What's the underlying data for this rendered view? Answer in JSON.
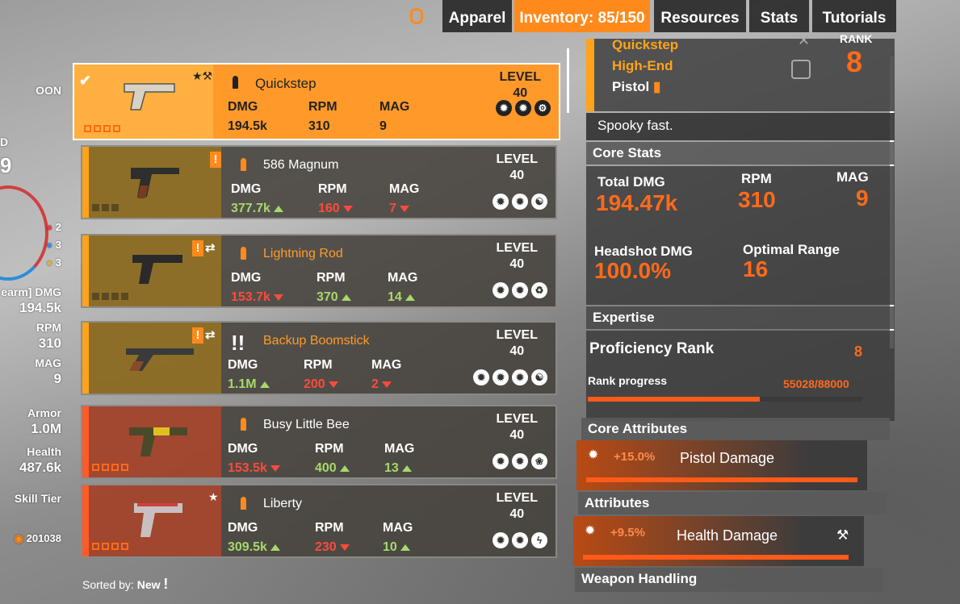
{
  "colors": {
    "accent": "#ff8a1c",
    "stat_up": "#a6d96a",
    "stat_down": "#ff4a3a"
  },
  "nav": {
    "tabs": [
      {
        "label": "Apparel",
        "active": false
      },
      {
        "label": "Inventory: 85/150",
        "active": true
      },
      {
        "label": "Resources",
        "active": false
      },
      {
        "label": "Stats",
        "active": false
      },
      {
        "label": "Tutorials",
        "active": false
      }
    ]
  },
  "left": {
    "title_fragment": "OON",
    "d_fragment": "D",
    "nine_fragment": "9",
    "counts": [
      "2",
      "3",
      "3"
    ],
    "dmg_label": "earm] DMG",
    "dmg_value": "194.5k",
    "rpm_label": "RPM",
    "rpm_value": "310",
    "mag_label": "MAG",
    "mag_value": "9",
    "armor_label": "Armor",
    "armor_value": "1.0M",
    "health_label": "Health",
    "health_value": "487.6k",
    "skill_tier_label": "Skill Tier",
    "currency": "201038"
  },
  "weapons": [
    {
      "name": "Quickstep",
      "level_label": "LEVEL",
      "level": "40",
      "dmg_label": "DMG",
      "rpm_label": "RPM",
      "mag_label": "MAG",
      "dmg": "194.5k",
      "rpm": "310",
      "mag": "9",
      "star_text": "★⚒"
    },
    {
      "name": "586 Magnum",
      "level_label": "LEVEL",
      "level": "40",
      "dmg_label": "DMG",
      "rpm_label": "RPM",
      "mag_label": "MAG",
      "dmg": "377.7k",
      "rpm": "160",
      "mag": "7",
      "badge": "!"
    },
    {
      "name": "Lightning Rod",
      "level_label": "LEVEL",
      "level": "40",
      "dmg_label": "DMG",
      "rpm_label": "RPM",
      "mag_label": "MAG",
      "dmg": "153.7k",
      "rpm": "370",
      "mag": "14",
      "badge": "!",
      "swap": "⇄"
    },
    {
      "name": "Backup Boomstick",
      "level_label": "LEVEL",
      "level": "40",
      "dmg_label": "DMG",
      "rpm_label": "RPM",
      "mag_label": "MAG",
      "dmg": "1.1M",
      "rpm": "200",
      "mag": "2",
      "badge": "!",
      "swap": "⇄"
    },
    {
      "name": "Busy Little Bee",
      "level_label": "LEVEL",
      "level": "40",
      "dmg_label": "DMG",
      "rpm_label": "RPM",
      "mag_label": "MAG",
      "dmg": "153.5k",
      "rpm": "400",
      "mag": "13"
    },
    {
      "name": "Liberty",
      "level_label": "LEVEL",
      "level": "40",
      "dmg_label": "DMG",
      "rpm_label": "RPM",
      "mag_label": "MAG",
      "dmg": "309.5k",
      "rpm": "230",
      "mag": "10",
      "star_text": "★"
    }
  ],
  "sorted": {
    "label": "Sorted by:",
    "value": "New",
    "mark": "!"
  },
  "detail": {
    "name": "Quickstep",
    "rarity": "High-End",
    "type": "Pistol",
    "rank_label": "RANK",
    "rank": "8",
    "flavor": "Spooky fast.",
    "core_stats_header": "Core Stats",
    "total_dmg_label": "Total DMG",
    "total_dmg": "194.47k",
    "rpm_label": "RPM",
    "rpm": "310",
    "mag_label": "MAG",
    "mag": "9",
    "headshot_label": "Headshot DMG",
    "headshot": "100.0%",
    "range_label": "Optimal Range",
    "range": "16",
    "expertise_header": "Expertise",
    "proficiency_label": "Proficiency Rank",
    "proficiency_rank": "8",
    "rank_progress_label": "Rank progress",
    "rank_progress_text": "55028/88000",
    "rank_progress_fraction": 0.625,
    "core_attr_header": "Core Attributes",
    "core_attr_value": "+15.0%",
    "core_attr_name": "Pistol Damage",
    "core_attr_fraction": 1.0,
    "attr_header": "Attributes",
    "attr_value": "+9.5%",
    "attr_name": "Health Damage",
    "attr_fraction": 0.98,
    "handling_header": "Weapon Handling"
  }
}
